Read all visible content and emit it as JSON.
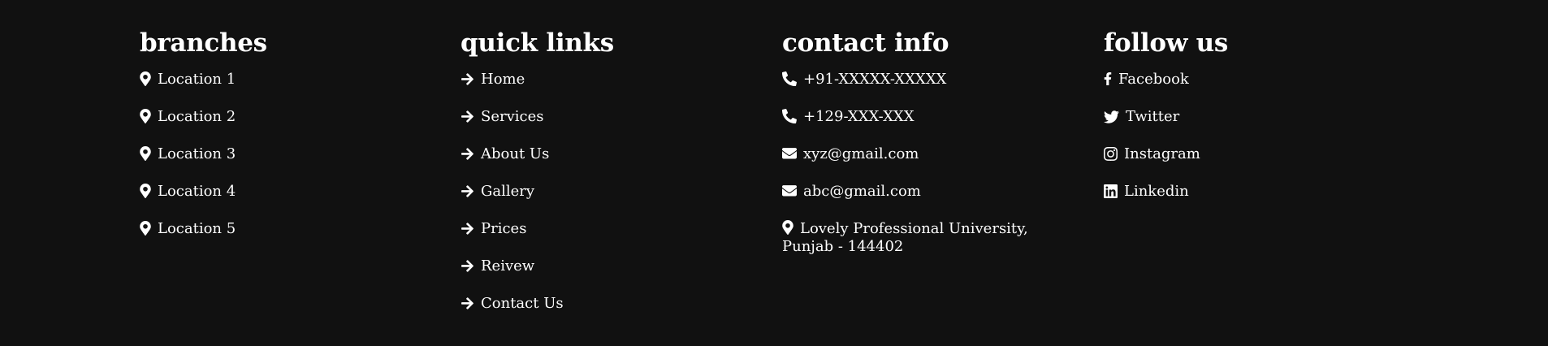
{
  "branches": {
    "title": "branches",
    "items": [
      "Location 1",
      "Location 2",
      "Location 3",
      "Location 4",
      "Location 5"
    ],
    "icon": "map-marker-icon"
  },
  "quick_links": {
    "title": "quick links",
    "items": [
      "Home",
      "Services",
      "About Us",
      "Gallery",
      "Prices",
      "Reivew",
      "Contact Us"
    ],
    "icon": "arrow-right-icon"
  },
  "contact_info": {
    "title": "contact info",
    "items": [
      {
        "icon": "phone-icon",
        "text": "+91-XXXXX-XXXXX"
      },
      {
        "icon": "phone-icon",
        "text": "+129-XXX-XXX"
      },
      {
        "icon": "envelope-icon",
        "text": "xyz@gmail.com"
      },
      {
        "icon": "envelope-icon",
        "text": "abc@gmail.com"
      },
      {
        "icon": "map-marker-icon",
        "text": "Lovely Professional University, Punjab - 144402"
      }
    ]
  },
  "follow_us": {
    "title": "follow us",
    "items": [
      {
        "icon": "facebook-icon",
        "text": "Facebook"
      },
      {
        "icon": "twitter-icon",
        "text": "Twitter"
      },
      {
        "icon": "instagram-icon",
        "text": "Instagram"
      },
      {
        "icon": "linkedin-icon",
        "text": "Linkedin"
      }
    ]
  },
  "colors": {
    "background": "#111111",
    "text": "#ffffff"
  }
}
